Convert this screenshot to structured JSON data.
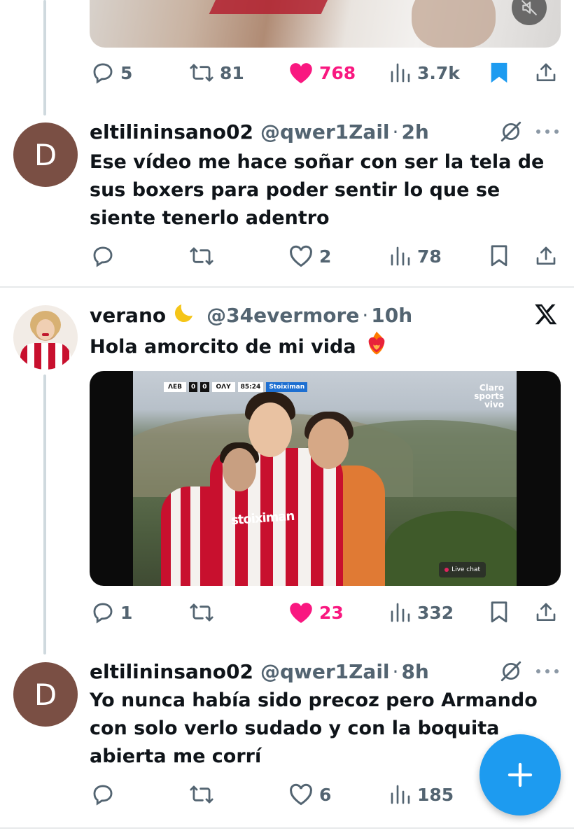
{
  "tweets": [
    {
      "id": "top",
      "stats": {
        "replies": "5",
        "retweets": "81",
        "likes": "768",
        "views": "3.7k"
      },
      "liked": true,
      "bookmarked": true
    },
    {
      "id": "reply1",
      "avatar_letter": "D",
      "name": "eltilininsano02",
      "handle": "@qwer1Zail",
      "separator": "·",
      "time": "2h",
      "text": "Ese vídeo me hace soñar con ser la tela de sus boxers para poder sentir lo que se siente tenerlo adentro",
      "stats": {
        "replies": "",
        "retweets": "",
        "likes": "2",
        "views": "78"
      }
    },
    {
      "id": "quote",
      "name": "verano",
      "handle": "@34evermore",
      "separator": "·",
      "time": "10h",
      "text": "Hola amorcito de mi vida",
      "emoji": "❤️‍🔥",
      "video": {
        "scorebug": {
          "home": "ΛΕΒ",
          "score_home": "0",
          "score_away": "0",
          "away": "ΟΛΥ",
          "clock": "85:24",
          "sponsor": "Stoiximan"
        },
        "broadcaster": "Claro sports vivo",
        "shirt_sponsor": "stoiximan",
        "live_chat": "Live chat"
      },
      "stats": {
        "replies": "1",
        "retweets": "",
        "likes": "23",
        "views": "332"
      },
      "liked": true
    },
    {
      "id": "reply2",
      "avatar_letter": "D",
      "name": "eltilininsano02",
      "handle": "@qwer1Zail",
      "separator": "·",
      "time": "8h",
      "text": "Yo nunca había sido precoz pero Armando con solo verlo sudado y con la boquita abierta me corrí",
      "stats": {
        "replies": "",
        "retweets": "",
        "likes": "6",
        "views": "185"
      }
    }
  ],
  "colors": {
    "like_pink": "#f91880",
    "accent_blue": "#1d9bf0",
    "muted_gray": "#536471",
    "avatar_brown": "#7a4f44"
  },
  "icons": [
    "reply-icon",
    "retweet-icon",
    "like-icon",
    "views-icon",
    "bookmark-icon",
    "share-icon",
    "grok-icon",
    "more-icon",
    "x-logo-icon",
    "mute-icon",
    "compose-plus-icon"
  ]
}
